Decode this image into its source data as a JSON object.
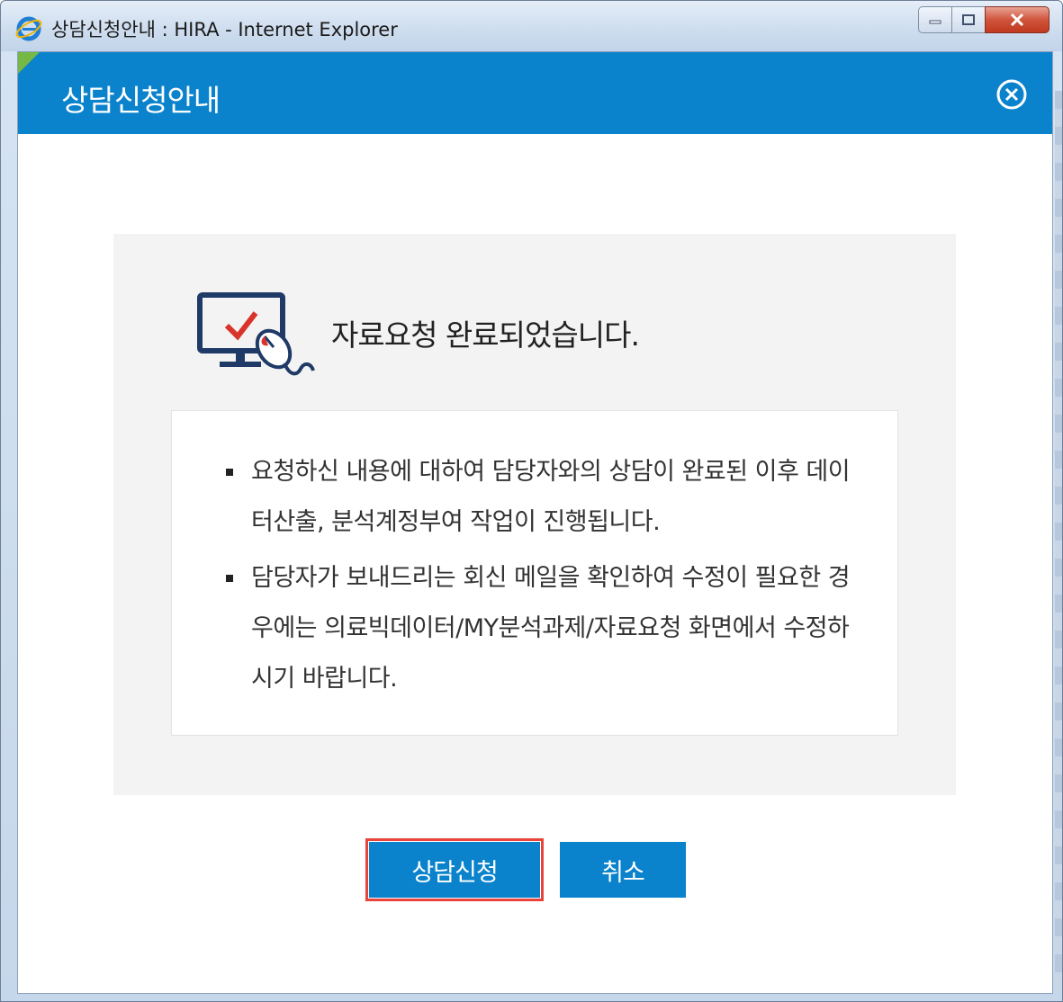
{
  "window": {
    "title": "상담신청안내 : HIRA - Internet Explorer",
    "browser_icon": "ie-icon",
    "controls": [
      "minimize-icon",
      "maximize-icon",
      "close-icon"
    ]
  },
  "dialog": {
    "header_title": "상담신청안내",
    "header_close_icon": "circle-x-icon",
    "accent_color": "#0a82cc",
    "corner_color": "#75b845"
  },
  "message": {
    "icon": "monitor-check-mouse-icon",
    "title": "자료요청 완료되었습니다."
  },
  "notices": [
    {
      "text": "요청하신 내용에 대하여 담당자와의 상담이 완료된 이후 데이터산출, 분석계정부여 작업이 진행됩니다."
    },
    {
      "text": "담당자가 보내드리는 회신 메일을 확인하여 수정이 필요한 경우에는 의료빅데이터/MY분석과제/자료요청 화면에서 수정하시기 바랍니다."
    }
  ],
  "buttons": {
    "apply_label": "상담신청",
    "cancel_label": "취소",
    "highlight_color": "#e8443c"
  }
}
